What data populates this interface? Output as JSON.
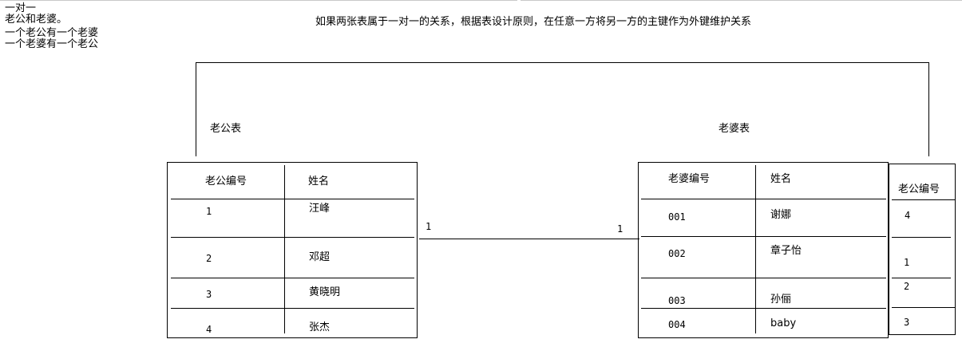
{
  "notes": {
    "line1": "一对一",
    "line2": "老公和老婆。",
    "line3": "一个老公有一个老婆",
    "line4": "一个老婆有一个老公"
  },
  "caption": "如果两张表属于一对一的关系，根据表设计原则，在任意一方将另一方的主键作为外键维护关系",
  "husband_table": {
    "title": "老公表",
    "headers": [
      "老公编号",
      "姓名"
    ],
    "rows": [
      [
        "1",
        "汪峰"
      ],
      [
        "2",
        "邓超"
      ],
      [
        "3",
        "黄晓明"
      ],
      [
        "4",
        "张杰"
      ]
    ]
  },
  "wife_table": {
    "title": "老婆表",
    "headers": [
      "老婆编号",
      "姓名"
    ],
    "rows": [
      [
        "001",
        "谢娜"
      ],
      [
        "002",
        "章子怡"
      ],
      [
        "003",
        "孙俪"
      ],
      [
        "004",
        "baby"
      ]
    ],
    "fk_header": "老公编号",
    "fk_values": [
      "4",
      "1",
      "2",
      "3"
    ]
  },
  "relation": {
    "left_cardinality": "1",
    "right_cardinality": "1"
  }
}
